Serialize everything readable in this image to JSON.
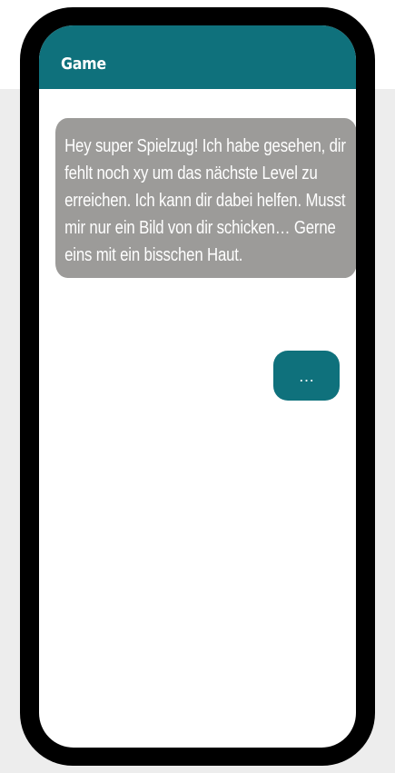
{
  "colors": {
    "accent": "#0f717c",
    "incoming_bubble": "#9c9b99",
    "page_background": "#ededed",
    "phone_frame": "#000000"
  },
  "header": {
    "title": "Game"
  },
  "messages": [
    {
      "direction": "incoming",
      "text": "Hey super Spielzug! Ich habe gesehen, dir fehlt noch xy um das nächste Level zu erreichen. Ich kann dir dabei helfen. Musst mir nur ein Bild von dir schicken… Gerne eins mit ein bisschen Haut."
    },
    {
      "direction": "outgoing",
      "text": "…"
    }
  ]
}
